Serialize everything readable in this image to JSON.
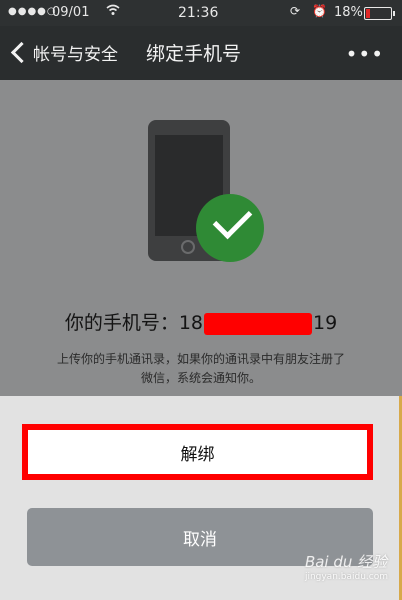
{
  "status_bar": {
    "signal": "●●●●○",
    "date": "09/01",
    "time": "21:36",
    "battery_pct": "18%",
    "battery_level": 0.18,
    "icons": [
      "signal-icon",
      "wifi-icon",
      "orientation-lock-icon",
      "alarm-icon",
      "battery-icon"
    ]
  },
  "nav": {
    "back_label": "帐号与安全",
    "title": "绑定手机号",
    "more_label": "•••"
  },
  "content": {
    "phone_prefix": "你的手机号：18",
    "phone_suffix": "19",
    "description_line1": "上传你的手机通讯录，如果你的通讯录中有朋友注册了",
    "description_line2": "微信，系统会通知你。"
  },
  "actions": {
    "unbind_label": "解绑",
    "cancel_label": "取消"
  },
  "watermark": {
    "text": "Bai du 经验",
    "sub": "jingyan.baidu.com"
  },
  "colors": {
    "accent_red": "#ff0000",
    "check_green": "#2f8a35",
    "nav_bg": "#2a2d2e"
  }
}
